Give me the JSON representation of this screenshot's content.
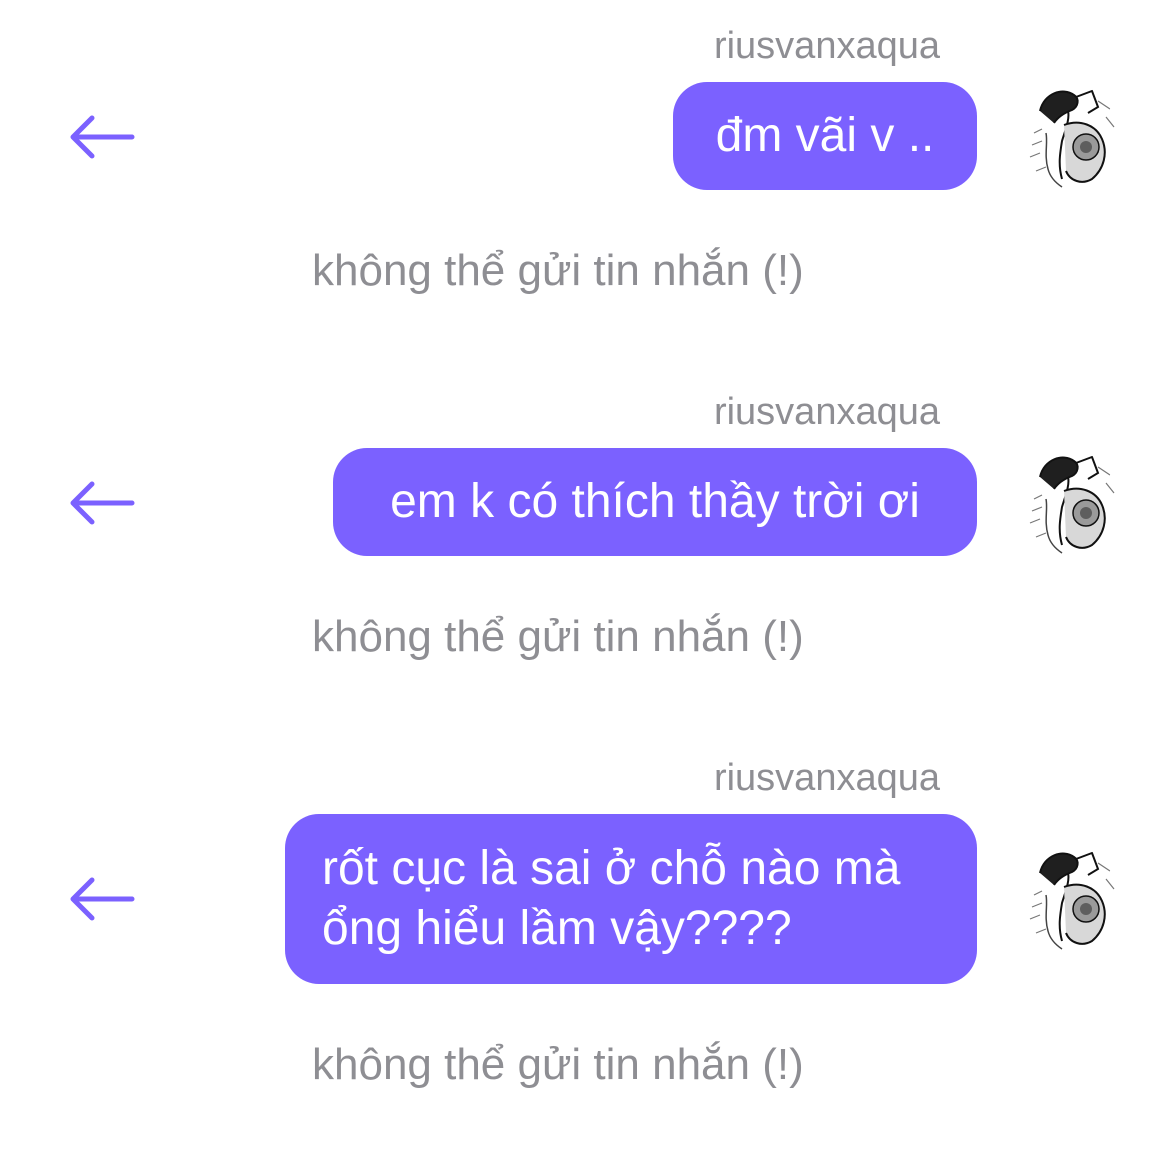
{
  "colors": {
    "accent": "#7b61ff",
    "bubble_text": "#ffffff",
    "muted_text": "#8e8e93",
    "background": "#ffffff"
  },
  "icons": {
    "back": "left-arrow-icon",
    "avatar": "sketch-avatar-image"
  },
  "messages": [
    {
      "sender": "riusvanxaqua",
      "text": "đm vãi v ..",
      "status": "không thể gửi tin nhắn (!)"
    },
    {
      "sender": "riusvanxaqua",
      "text": "em k có thích thầy trời ơi",
      "status": "không thể gửi tin nhắn (!)"
    },
    {
      "sender": "riusvanxaqua",
      "text": "rốt cục là sai ở chỗ nào mà ổng hiểu lầm vậy????",
      "status": "không thể gửi tin nhắn (!)"
    }
  ]
}
